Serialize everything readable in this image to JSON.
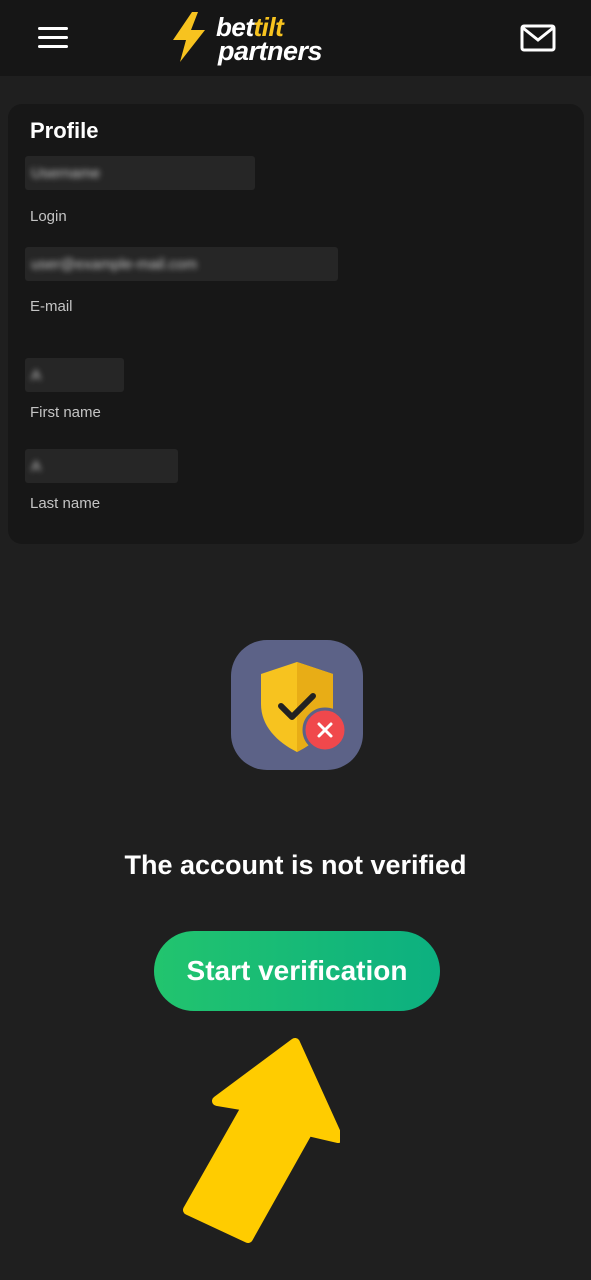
{
  "header": {
    "logo_prefix": "bet",
    "logo_accent": "tilt",
    "logo_line2": "partners",
    "menu_icon": "hamburger-icon",
    "mail_icon": "mail-icon"
  },
  "profile": {
    "title": "Profile",
    "fields": [
      {
        "label": "Login",
        "value": "Username"
      },
      {
        "label": "E-mail",
        "value": "user@example-mail.com"
      },
      {
        "label": "First name",
        "value": "A"
      },
      {
        "label": "Last name",
        "value": "A"
      }
    ]
  },
  "verification": {
    "status": "The account is not verified",
    "button_label": "Start verification",
    "icon": "shield-check-icon",
    "badge_icon": "close-icon"
  },
  "colors": {
    "background": "#1f1f1f",
    "header": "#161616",
    "card": "#171717",
    "brand_yellow": "#f7c31f",
    "tile": "#5c6287",
    "error_red": "#f0484c",
    "button_start": "#22c46e",
    "button_end": "#0cb080"
  }
}
